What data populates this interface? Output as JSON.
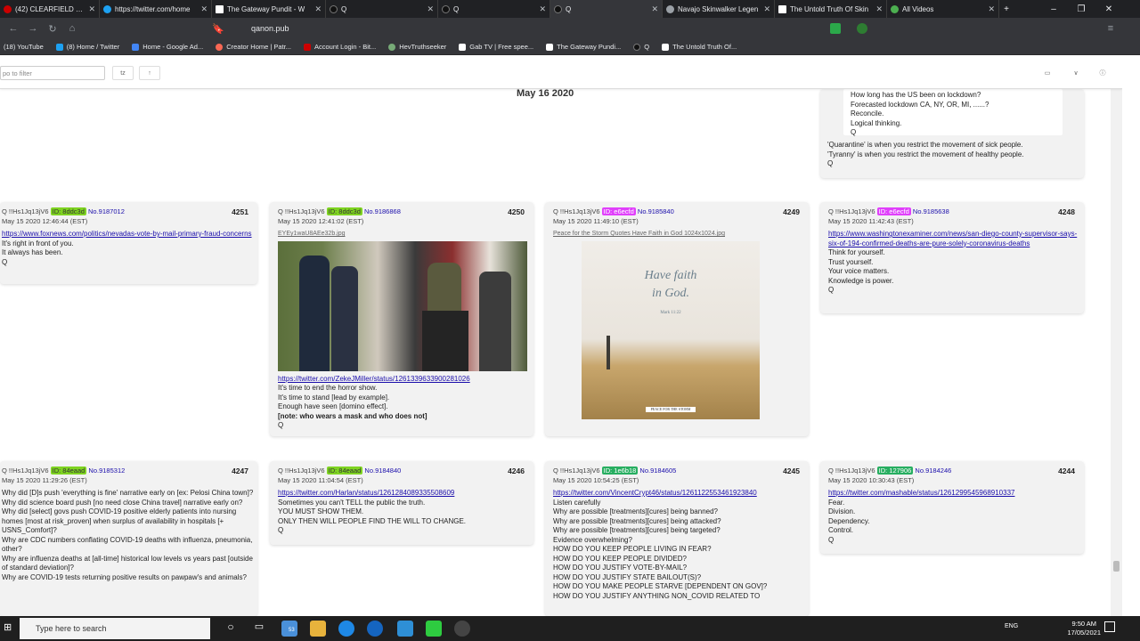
{
  "tabs": [
    {
      "label": "(42) CLEARFIELD DOCTRI",
      "active": false
    },
    {
      "label": "https://twitter.com/home",
      "active": false
    },
    {
      "label": "The Gateway Pundit - W",
      "active": false
    },
    {
      "label": "Q",
      "active": false
    },
    {
      "label": "Q",
      "active": false
    },
    {
      "label": "Q",
      "active": true
    },
    {
      "label": "Navajo Skinwalker Legen",
      "active": false
    },
    {
      "label": "The Untold Truth Of Skin",
      "active": false
    },
    {
      "label": "All Videos",
      "active": false
    }
  ],
  "url": "qanon.pub",
  "bookmarks": [
    "(18) YouTube",
    "(8) Home / Twitter",
    "Home - Google Ad...",
    "Creator Home | Patr...",
    "Account Login - Bit...",
    "HevTruthseeker",
    "Gab TV | Free spee...",
    "The Gateway Pundi...",
    "Q",
    "The Untold Truth Of..."
  ],
  "filter_placeholder": "po to filter",
  "filter_buttons": [
    "tz",
    "↑"
  ],
  "date_header": "May 16 2020",
  "top_card": {
    "lines": [
      "How long has the US been on lockdown?",
      "Forecasted lockdown CA, NY, OR, MI, ......?",
      "Reconcile.",
      "Logical thinking.",
      "Q"
    ],
    "text1": "'Quarantine' is when you restrict the movement of sick people.",
    "text2": "'Tyranny' is when you restrict the movement of healthy people.",
    "sig": "Q"
  },
  "posts": [
    {
      "num": "4251",
      "author": "Q !!Hs1Jq13jV6",
      "id": "ID: 8ddc3d",
      "no": "No.9187012",
      "date": "May 15 2020 12:46:44 (EST)",
      "link": "https://www.foxnews.com/politics/nevadas-vote-by-mail-primary-fraud-concerns",
      "lines": [
        "It's right in front of you.",
        "It always has been.",
        "Q"
      ]
    },
    {
      "num": "4250",
      "author": "Q !!Hs1Jq13jV6",
      "id": "ID: 8ddc3d",
      "no": "No.9186868",
      "date": "May 15 2020 12:41:02 (EST)",
      "imgname": "EYEy1waU8AEe32b.jpg",
      "link": "https://twitter.com/ZekeJMiller/status/1261339633900281026",
      "lines": [
        "It's time to end the horror show.",
        "It's time to stand [lead by example].",
        "Enough have seen [domino effect].",
        "[note: who wears a mask and who does not]",
        "Q"
      ]
    },
    {
      "num": "4249",
      "author": "Q !!Hs1Jq13jV6",
      "id": "ID: e6ecfd",
      "no": "No.9185840",
      "date": "May 15 2020 11:49:10 (EST)",
      "imgname": "Peace for the Storm Quotes Have Faith in God 1024x1024.jpg",
      "img_text1": "Have faith",
      "img_text2": "in God.",
      "img_text3": "Mark 11:22",
      "img_foot": "PEACE FOR THE STORM",
      "lines": []
    },
    {
      "num": "4248",
      "author": "Q !!Hs1Jq13jV6",
      "id": "ID: e6ecfd",
      "no": "No.9185638",
      "date": "May 15 2020 11:42:43 (EST)",
      "link": "https://www.washingtonexaminer.com/news/san-diego-county-supervisor-says-six-of-194-confirmed-deaths-are-pure-solely-coronavirus-deaths",
      "lines": [
        "Think for yourself.",
        "Trust yourself.",
        "Your voice matters.",
        "Knowledge is power.",
        "Q"
      ]
    },
    {
      "num": "4247",
      "author": "Q !!Hs1Jq13jV6",
      "id": "ID: 84eaad",
      "no": "No.9185312",
      "date": "May 15 2020 11:29:26 (EST)",
      "lines": [
        "Why did [D]s push 'everything is fine' narrative early on [ex: Pelosi China town]?",
        "Why did science board push [no need close China travel] narrative early on?",
        "Why did [select] govs push COVID-19 positive elderly patients into nursing homes [most at risk_proven] when surplus of availability in hospitals [+ USNS_Comfort]?",
        "Why are CDC numbers conflating COVID-19 deaths with influenza, pneumonia, other?",
        "Why are influenza deaths at [all-time] historical low levels vs years past [outside of standard deviation]?",
        "Why are COVID-19 tests returning positive results on pawpaw's and animals?"
      ]
    },
    {
      "num": "4246",
      "author": "Q !!Hs1Jq13jV6",
      "id": "ID: 84eaad",
      "no": "No.9184840",
      "date": "May 15 2020 11:04:54 (EST)",
      "link": "https://twitter.com/Harlan/status/1261284089335508609",
      "lines": [
        "Sometimes you can't TELL the public the truth.",
        "YOU MUST SHOW THEM.",
        "ONLY THEN WILL PEOPLE FIND THE WILL TO CHANGE.",
        "Q"
      ]
    },
    {
      "num": "4245",
      "author": "Q !!Hs1Jq13jV6",
      "id": "ID: 1e6b18",
      "no": "No.9184605",
      "date": "May 15 2020 10:54:25 (EST)",
      "link": "https://twitter.com/VincentCrypt46/status/1261122553461923840",
      "lines": [
        "Listen carefully",
        "Why are possible [treatments][cures] being banned?",
        "Why are possible [treatments][cures] being attacked?",
        "Why are possible [treatments][cures] being targeted?",
        "Evidence overwhelming?",
        "HOW DO YOU KEEP PEOPLE LIVING IN FEAR?",
        "HOW DO YOU KEEP PEOPLE DIVIDED?",
        "HOW DO YOU JUSTIFY VOTE-BY-MAIL?",
        "HOW DO YOU JUSTIFY STATE BAILOUT(S)?",
        "HOW DO YOU MAKE PEOPLE STARVE [DEPENDENT ON GOV]?",
        "HOW DO YOU JUSTIFY ANYTHING NON_COVID RELATED TO"
      ]
    },
    {
      "num": "4244",
      "author": "Q !!Hs1Jq13jV6",
      "id": "ID: 127906",
      "no": "No.9184246",
      "date": "May 15 2020 10:30:43 (EST)",
      "link": "https://twitter.com/mashable/status/1261299545968910337",
      "lines": [
        "Fear.",
        "Division.",
        "Dependency.",
        "Control.",
        "Q"
      ]
    }
  ],
  "taskbar": {
    "search_placeholder": "Type here to search",
    "time": "9:50 AM",
    "date": "17/05/2021",
    "lang": "ENG",
    "badge": "53"
  }
}
